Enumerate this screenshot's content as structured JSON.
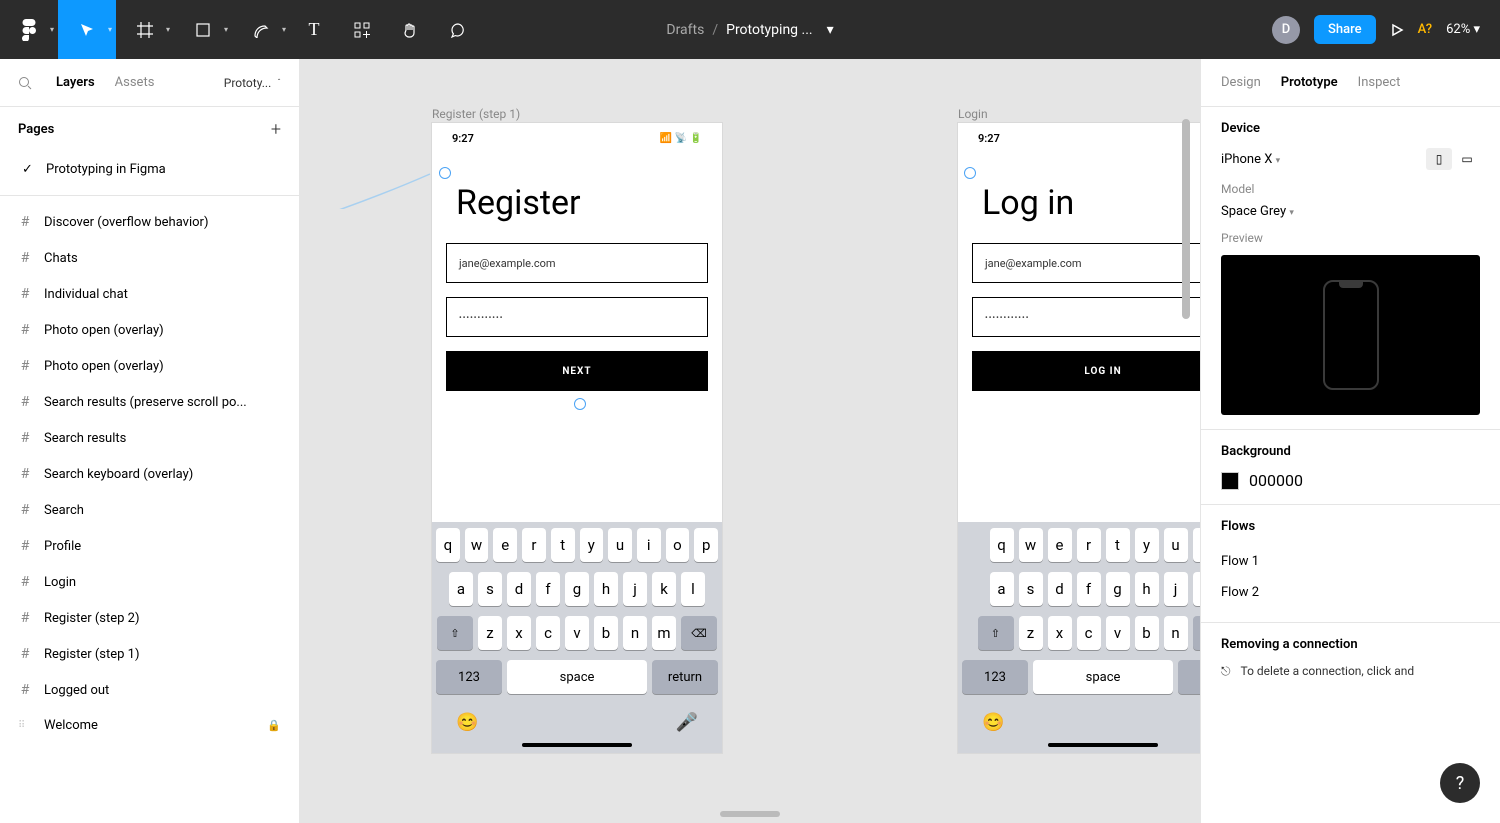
{
  "toolbar": {
    "breadcrumb_parent": "Drafts",
    "breadcrumb_file": "Prototyping ...",
    "avatar_initial": "D",
    "share_label": "Share",
    "a_question": "A?",
    "zoom": "62%"
  },
  "left": {
    "tabs": {
      "layers": "Layers",
      "assets": "Assets"
    },
    "page_selector": "Prototy...",
    "pages_header": "Pages",
    "current_page": "Prototyping in Figma",
    "layers": [
      "Discover (overflow behavior)",
      "Chats",
      "Individual chat",
      "Photo open (overlay)",
      "Photo open (overlay)",
      "Search results (preserve scroll po...",
      "Search results",
      "Search keyboard (overlay)",
      "Search",
      "Profile",
      "Login",
      "Register (step 2)",
      "Register (step 1)",
      "Logged out"
    ],
    "welcome_layer": "Welcome"
  },
  "canvas": {
    "frame1": {
      "label": "Register (step 1)",
      "time": "9:27",
      "title": "Register",
      "email": "jane@example.com",
      "password": "••••••••••••",
      "button": "NEXT"
    },
    "frame2": {
      "label": "Login",
      "time": "9:27",
      "title": "Log in",
      "email": "jane@example.com",
      "password": "••••••••••••",
      "button": "LOG IN"
    },
    "keyboard": {
      "row1": [
        "q",
        "w",
        "e",
        "r",
        "t",
        "y",
        "u",
        "i",
        "o",
        "p"
      ],
      "row2": [
        "a",
        "s",
        "d",
        "f",
        "g",
        "h",
        "j",
        "k",
        "l"
      ],
      "row3": [
        "z",
        "x",
        "c",
        "v",
        "b",
        "n",
        "m"
      ],
      "num": "123",
      "space": "space",
      "return": "return"
    }
  },
  "right": {
    "tabs": {
      "design": "Design",
      "prototype": "Prototype",
      "inspect": "Inspect"
    },
    "device": {
      "header": "Device",
      "name": "iPhone X",
      "model_label": "Model",
      "model": "Space Grey",
      "preview_label": "Preview"
    },
    "background": {
      "header": "Background",
      "value": "000000"
    },
    "flows": {
      "header": "Flows",
      "items": [
        "Flow 1",
        "Flow 2"
      ]
    },
    "removing": {
      "header": "Removing a connection",
      "tip": "To delete a connection, click and"
    }
  }
}
